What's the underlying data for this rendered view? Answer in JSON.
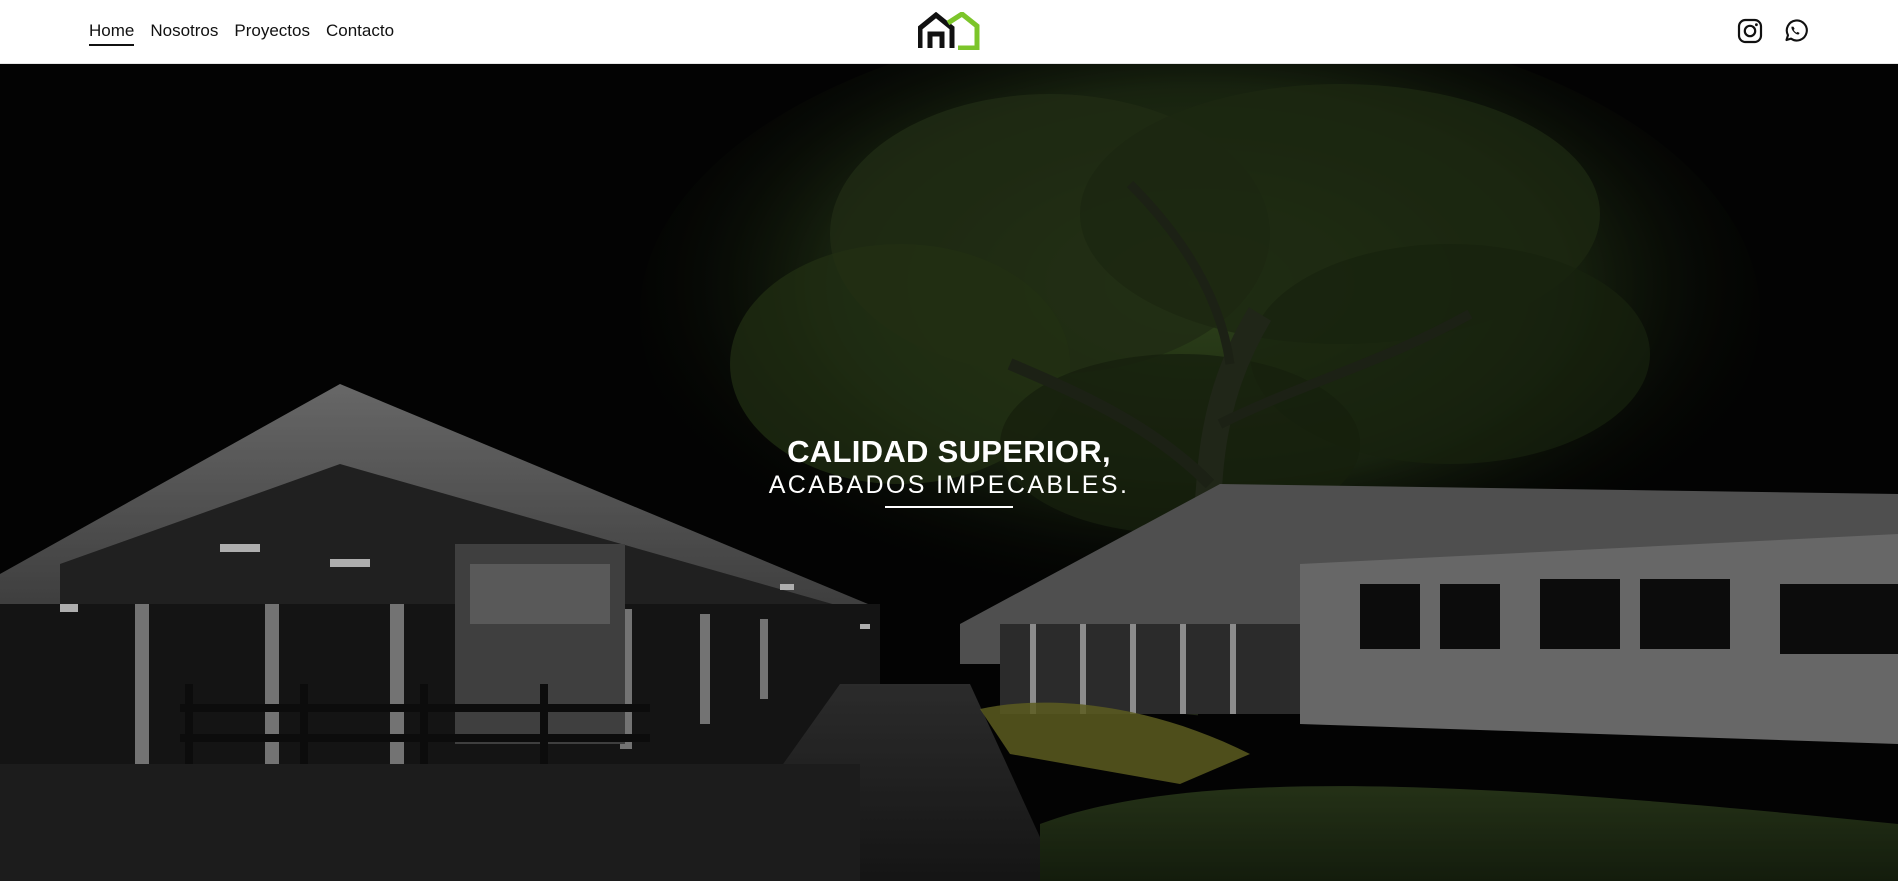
{
  "nav": {
    "items": [
      {
        "label": "Home",
        "active": true
      },
      {
        "label": "Nosotros",
        "active": false
      },
      {
        "label": "Proyectos",
        "active": false
      },
      {
        "label": "Contacto",
        "active": false
      }
    ]
  },
  "logo": {
    "icon": "house-logo-icon",
    "colors": {
      "dark": "#111111",
      "accent": "#7cc52a"
    }
  },
  "social": [
    {
      "icon": "instagram-icon"
    },
    {
      "icon": "whatsapp-icon"
    }
  ],
  "hero": {
    "title": "CALIDAD SUPERIOR,",
    "subtitle": "ACABADOS IMPECABLES.",
    "image": "night-stable-courtyard-with-tree-photo"
  }
}
